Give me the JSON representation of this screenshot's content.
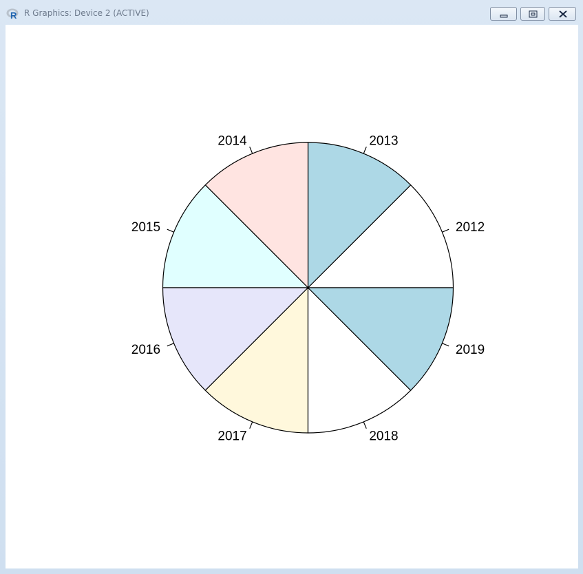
{
  "window": {
    "title": "R Graphics: Device 2 (ACTIVE)",
    "icon": "r-logo-icon",
    "controls": [
      "minimize-icon",
      "maximize-icon",
      "close-icon"
    ]
  },
  "chart_data": {
    "type": "pie",
    "title": "",
    "labels": [
      "2012",
      "2013",
      "2014",
      "2015",
      "2016",
      "2017",
      "2018",
      "2019"
    ],
    "values": [
      1,
      1,
      1,
      1,
      1,
      1,
      1,
      1
    ],
    "colors": [
      "#FFFFFF",
      "#ADD8E6",
      "#FFE4E1",
      "#E0FFFF",
      "#E6E6FA",
      "#FFF8DC",
      "#FFFFFF",
      "#ADD8E6"
    ],
    "start_angle_deg": 0,
    "direction": "counterclockwise",
    "border_color": "#000000"
  }
}
